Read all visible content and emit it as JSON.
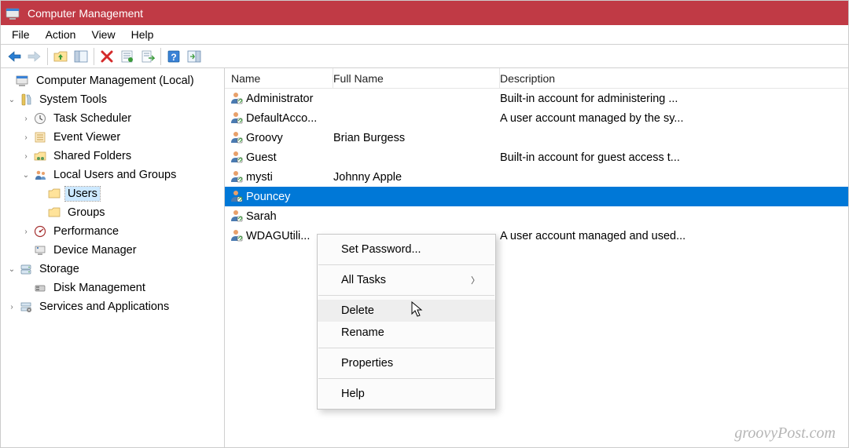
{
  "title": "Computer Management",
  "menubar": [
    "File",
    "Action",
    "View",
    "Help"
  ],
  "toolbar_buttons": [
    "back-icon",
    "forward-icon",
    "sep",
    "up-folder-icon",
    "show-hide-tree-icon",
    "sep",
    "delete-icon",
    "refresh-icon",
    "export-list-icon",
    "sep",
    "help-icon",
    "show-action-pane-icon"
  ],
  "tree": {
    "root": "Computer Management (Local)",
    "system_tools": "System Tools",
    "task_scheduler": "Task Scheduler",
    "event_viewer": "Event Viewer",
    "shared_folders": "Shared Folders",
    "local_users_groups": "Local Users and Groups",
    "users": "Users",
    "groups": "Groups",
    "performance": "Performance",
    "device_manager": "Device Manager",
    "storage": "Storage",
    "disk_management": "Disk Management",
    "services_apps": "Services and Applications"
  },
  "columns": {
    "name": "Name",
    "full_name": "Full Name",
    "description": "Description"
  },
  "users": [
    {
      "name": "Administrator",
      "full": "",
      "desc": "Built-in account for administering ..."
    },
    {
      "name": "DefaultAcco...",
      "full": "",
      "desc": "A user account managed by the sy..."
    },
    {
      "name": "Groovy",
      "full": "Brian Burgess",
      "desc": ""
    },
    {
      "name": "Guest",
      "full": "",
      "desc": "Built-in account for guest access t..."
    },
    {
      "name": "mysti",
      "full": "Johnny Apple",
      "desc": ""
    },
    {
      "name": "Pouncey",
      "full": "",
      "desc": "",
      "selected": true
    },
    {
      "name": "Sarah",
      "full": "",
      "desc": ""
    },
    {
      "name": "WDAGUtili...",
      "full": "",
      "desc": "A user account managed and used..."
    }
  ],
  "context_menu": {
    "set_password": "Set Password...",
    "all_tasks": "All Tasks",
    "delete": "Delete",
    "rename": "Rename",
    "properties": "Properties",
    "help": "Help"
  },
  "watermark": "groovyPost.com"
}
